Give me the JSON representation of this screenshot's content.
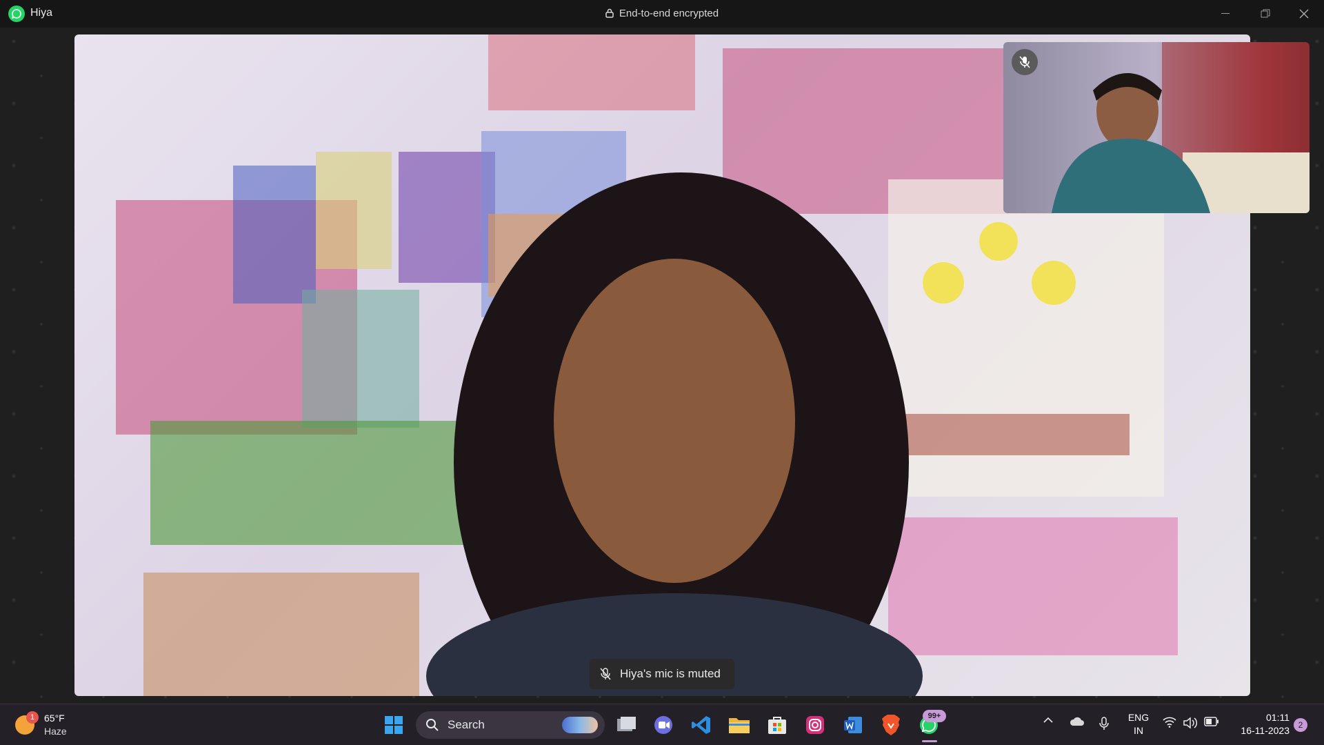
{
  "window": {
    "app_name": "Hiya",
    "encryption_label": "End-to-end encrypted"
  },
  "call": {
    "remote_participant_description": "Woman with long dark hair in front of a wall covered with colorful paintings",
    "self_participant_description": "Young man with glasses in teal sweater",
    "self_mic_state": "muted",
    "toast": "Hiya's mic is muted"
  },
  "taskbar": {
    "weather": {
      "badge": "1",
      "temperature": "65°F",
      "condition": "Haze"
    },
    "search_label": "Search",
    "pinned_apps": [
      "windows-start",
      "search",
      "task-view",
      "teams-meet",
      "vscode",
      "file-explorer",
      "microsoft-store",
      "instagram",
      "word",
      "brave",
      "whatsapp"
    ],
    "whatsapp_badge": "99+",
    "tray": {
      "language_line1": "ENG",
      "language_line2": "IN",
      "time": "01:11",
      "date": "16-11-2023",
      "notification_count": "2"
    }
  }
}
